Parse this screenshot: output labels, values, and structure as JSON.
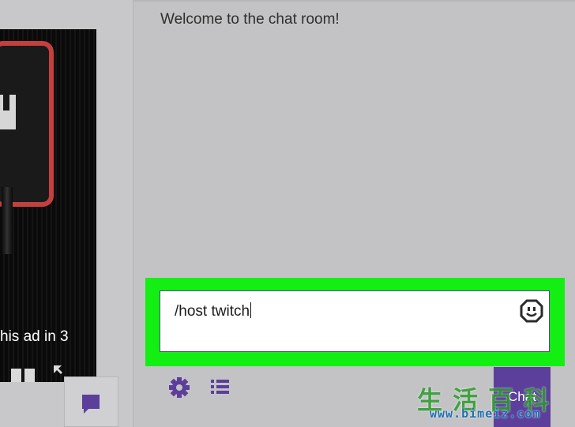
{
  "player": {
    "ad_text": "his ad in 3",
    "icons": {
      "pause": "pause-icon",
      "fullscreen": "expand-icon",
      "chat_toggle": "chat-bubble-icon"
    }
  },
  "chat": {
    "welcome_message": "Welcome to the chat room!",
    "input": {
      "value": "/host twitch"
    },
    "send_button_label": "Chat",
    "icons": {
      "emoji": "emoji-icon",
      "settings": "gear-icon",
      "viewer_list": "list-icon"
    }
  },
  "watermark": {
    "brand": "生活百科",
    "url": "www.bimeiz.com"
  },
  "colors": {
    "highlight": "#13ef13",
    "accent": "#5b3f9a",
    "background": "#c3c3c5"
  }
}
